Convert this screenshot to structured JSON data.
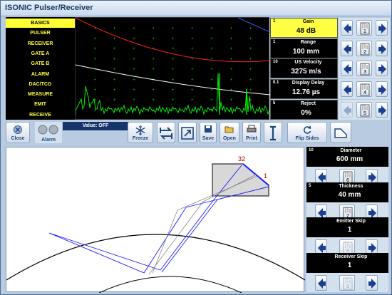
{
  "window": {
    "title": "ISONIC Pulser/Receiver"
  },
  "menu": {
    "items": [
      "BASICS",
      "PULSER",
      "RECEIVER",
      "GATE A",
      "GATE B",
      "ALARM",
      "DAC/TCG",
      "MEASURE",
      "EMIT",
      "RECEIVE"
    ],
    "selected": "BASICS"
  },
  "params": [
    {
      "index": "1",
      "name": "Gain",
      "value": "48 dB",
      "selected": true
    },
    {
      "index": "1",
      "name": "Range",
      "value": "100 mm"
    },
    {
      "index": "10",
      "name": "US Velocity",
      "value": "3275 m/s"
    },
    {
      "index": "0.1",
      "name": "Display Delay",
      "value": "12.76 µs"
    },
    {
      "index": "5",
      "name": "Reject",
      "value": "0%"
    }
  ],
  "step_labels": [
    "1",
    "2",
    "3",
    "4",
    "5"
  ],
  "toolbar": {
    "close_label": "Close",
    "alarm_label": "Alarm",
    "value_text": "Value: OFF",
    "freeze_label": "Freeze",
    "save_label": "Save",
    "open_label": "Open",
    "print_label": "Print",
    "flip_label": "Flip Sides"
  },
  "geometry_params": [
    {
      "index": "10",
      "name": "Diameter",
      "value": "600 mm",
      "step": "6"
    },
    {
      "index": "5",
      "name": "Thickness",
      "value": "40 mm",
      "step": "7"
    },
    {
      "index": "",
      "name": "Emitter Skip",
      "value": "1",
      "step": "8"
    },
    {
      "index": "",
      "name": "Receiver Skip",
      "value": "1",
      "step": "9"
    }
  ],
  "drawing": {
    "label_left": "32",
    "label_right": "1"
  },
  "colors": {
    "accent": "#ffff44",
    "arrow": "#1a3f8f",
    "waveform": "#00ff00",
    "tcg_curve": "#ff2020",
    "gate_curve": "#ffffff",
    "beam": "#1a1aff"
  }
}
